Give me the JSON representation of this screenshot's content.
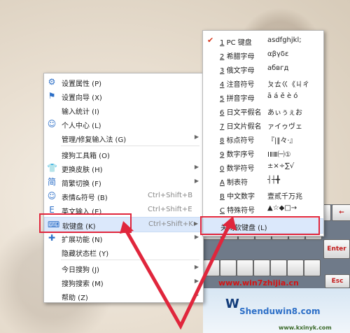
{
  "main_menu": {
    "items": [
      {
        "label": "设置属性 (P)"
      },
      {
        "label": "设置向导 (X)"
      },
      {
        "label": "输入统计 (I)"
      },
      {
        "label": "个人中心 (L)"
      },
      {
        "label": "管理/修复输入法 (G)"
      },
      {
        "label": "搜狗工具箱 (O)"
      },
      {
        "label": "更换皮肤 (H)"
      },
      {
        "label": "简繁切换 (F)"
      },
      {
        "label": "表情&符号 (B)",
        "shortcut": "Ctrl+Shift+B"
      },
      {
        "label": "英文输入 (E)",
        "shortcut": "Ctrl+Shift+E"
      },
      {
        "label": "软键盘 (K)",
        "shortcut": "Ctrl+Shift+K"
      },
      {
        "label": "扩展功能 (N)"
      },
      {
        "label": "隐藏状态栏 (Y)"
      },
      {
        "label": "今日搜狗 (J)"
      },
      {
        "label": "搜狗搜索 (M)"
      },
      {
        "label": "帮助 (Z)"
      }
    ]
  },
  "sub_menu": {
    "items": [
      {
        "num": "1",
        "label": "PC 键盘",
        "preview": "asdfghjkl;"
      },
      {
        "num": "2",
        "label": "希腊字母",
        "preview": "αβγδε"
      },
      {
        "num": "3",
        "label": "俄文字母",
        "preview": "абвгд"
      },
      {
        "num": "4",
        "label": "注音符号",
        "preview": "ㄆㄊㄍ《ㄐㄔ"
      },
      {
        "num": "5",
        "label": "拼音字母",
        "preview": "ā á ě è ó"
      },
      {
        "num": "6",
        "label": "日文平假名",
        "preview": "あぃぅぇお"
      },
      {
        "num": "7",
        "label": "日文片假名",
        "preview": "ァイゥヴェ"
      },
      {
        "num": "8",
        "label": "标点符号",
        "preview": "『|‖々·』"
      },
      {
        "num": "9",
        "label": "数字序号",
        "preview": "ⅠⅡⅢ㈠①"
      },
      {
        "num": "0",
        "label": "数学符号",
        "preview": "±×÷∑√"
      },
      {
        "num": "A",
        "label": "制表符",
        "preview": "┤┼╋"
      },
      {
        "num": "B",
        "label": "中文数字",
        "preview": "壹贰千万兆"
      },
      {
        "num": "C",
        "label": "特殊符号",
        "preview": "▲☆◆□→"
      }
    ],
    "close_label": "关闭软键盘 (L)"
  },
  "keyboard": {
    "esc": "Esc",
    "enter": "Enter",
    "back": "←"
  },
  "watermark": {
    "site1": "www.win7zhijia.cn",
    "site2": "Shenduwin8.com",
    "site3": "www.kxinyk.com"
  }
}
